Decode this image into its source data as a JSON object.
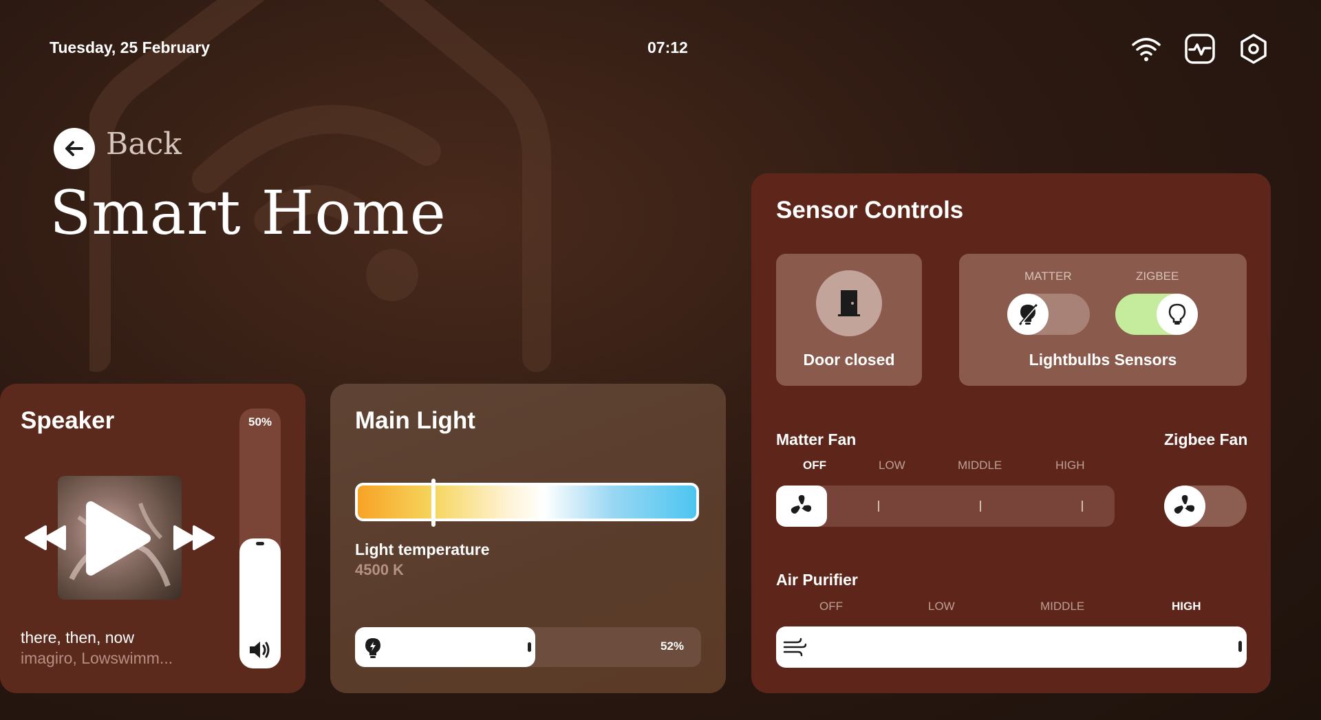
{
  "header": {
    "date": "Tuesday, 25 February",
    "time": "07:12",
    "icons": [
      "wifi-icon",
      "activity-monitor-icon",
      "settings-hex-icon"
    ]
  },
  "navigation": {
    "back_label": "Back",
    "page_title": "Smart Home"
  },
  "speaker": {
    "title": "Speaker",
    "volume_percent_label": "50%",
    "volume_level": 0.5,
    "track_title": "there, then, now",
    "track_artist": "imagiro, Lowswimm...",
    "controls": [
      "rewind-icon",
      "play-icon",
      "fast-forward-icon"
    ]
  },
  "main_light": {
    "title": "Main Light",
    "temperature_label": "Light temperature",
    "temperature_value": "4500 K",
    "brightness_label": "52%",
    "brightness_level": 0.52
  },
  "sensor_controls": {
    "title": "Sensor Controls",
    "door": {
      "label": "Door closed"
    },
    "bulbs": {
      "matter_label": "MATTER",
      "zigbee_label": "ZIGBEE",
      "matter_on": false,
      "zigbee_on": true,
      "label": "Lightbulbs Sensors"
    },
    "matter_fan": {
      "title": "Matter Fan",
      "levels": [
        "OFF",
        "LOW",
        "MIDDLE",
        "HIGH"
      ],
      "selected": "OFF"
    },
    "zigbee_fan": {
      "title": "Zigbee Fan",
      "on": false
    },
    "air_purifier": {
      "title": "Air Purifier",
      "levels": [
        "OFF",
        "LOW",
        "MIDDLE",
        "HIGH"
      ],
      "selected": "HIGH"
    }
  },
  "colors": {
    "accent_green": "#c5ec9c",
    "speaker_card": "#5b2a1c",
    "sensor_card": "#5e261a"
  }
}
